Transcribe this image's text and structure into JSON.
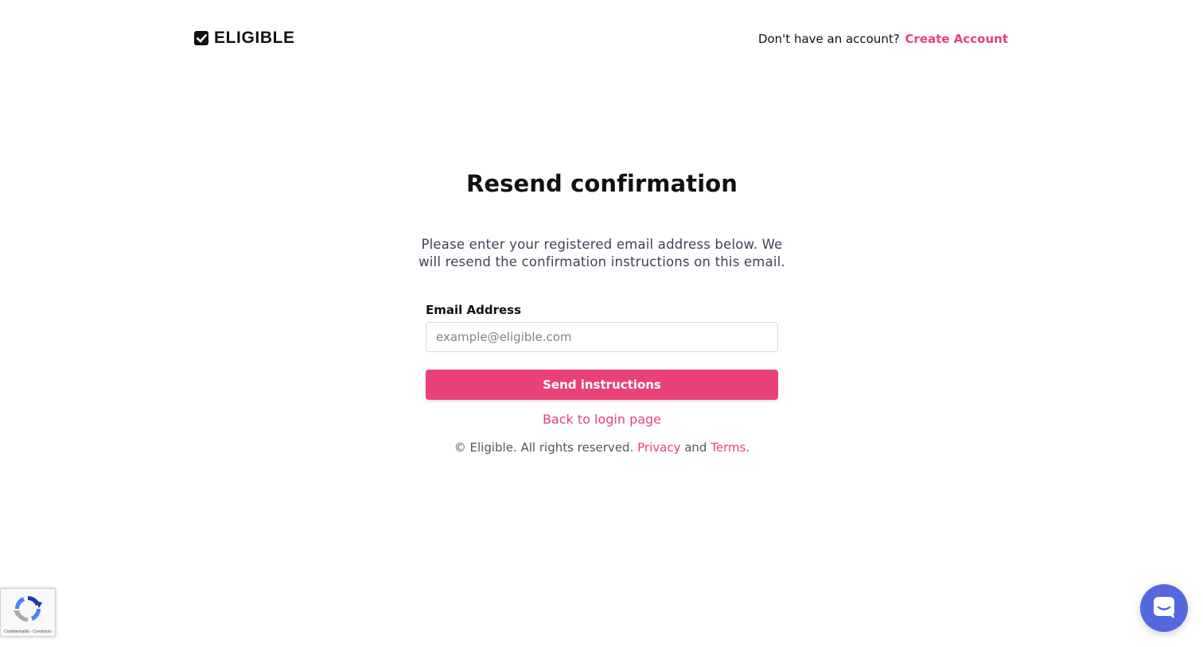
{
  "header": {
    "logo_text": "ELIGIBLE",
    "signup_prompt": "Don't have an account?",
    "signup_link": "Create Account"
  },
  "main": {
    "title": "Resend confirmation",
    "description": "Please enter your registered email address below. We will resend the confirmation instructions on this email.",
    "email_label": "Email Address",
    "email_value": "",
    "email_placeholder": "example@eligible.com",
    "submit_label": "Send instructions",
    "back_link": "Back to login page"
  },
  "footer": {
    "copyright": "© Eligible. All rights reserved.",
    "privacy": "Privacy",
    "and": "and",
    "terms": "Terms",
    "period": "."
  },
  "recaptcha": {
    "links": "Confidentialité - Conditions"
  },
  "icons": {
    "logo": "checkbox-icon",
    "recaptcha": "recaptcha-icon",
    "chat": "chat-bubble-icon"
  },
  "colors": {
    "accent": "#e8417b",
    "text": "#111111",
    "muted": "#3b4455",
    "chat": "#5468e0"
  }
}
